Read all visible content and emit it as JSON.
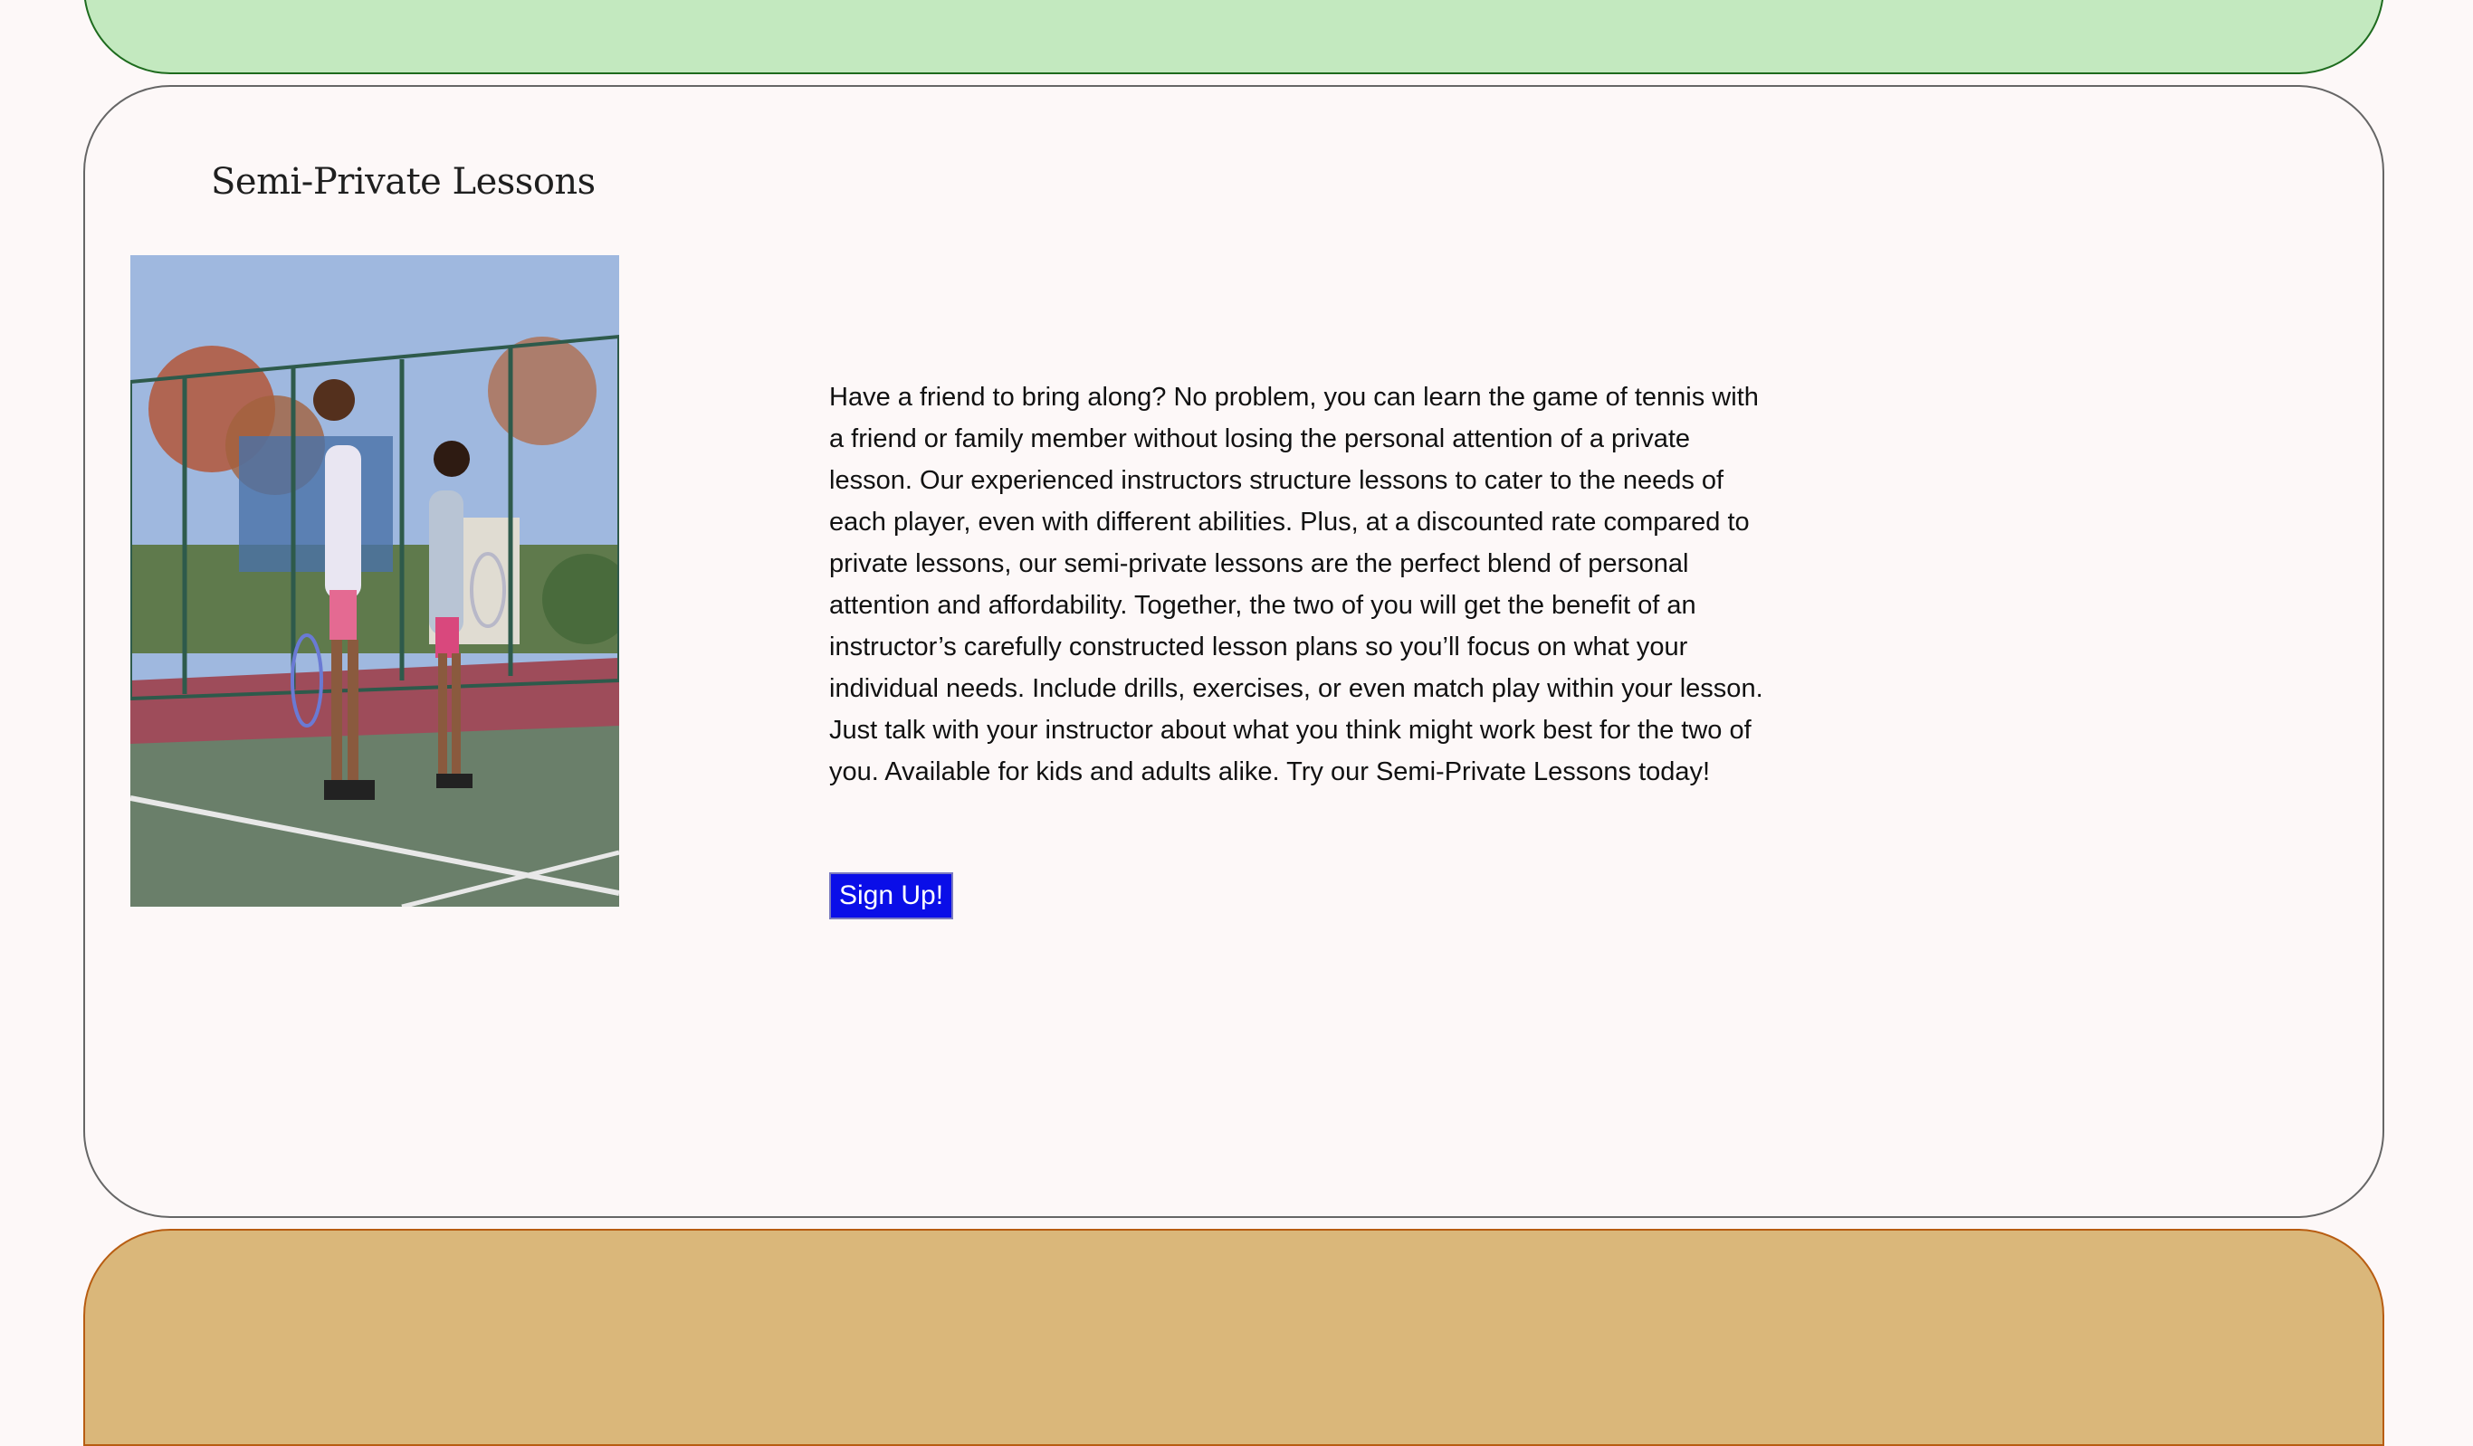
{
  "section": {
    "title": "Semi-Private Lessons",
    "description": "Have a friend to bring along? No problem, you can learn the game of tennis with a friend or family member without losing the personal attention of a private lesson. Our experienced instructors structure lessons to cater to the needs of each player, even with different abilities. Plus, at a discounted rate compared to private lessons, our semi-private lessons are the perfect blend of personal attention and affordability. Together, the two of you will get the benefit of an instructor’s carefully constructed lesson plans so you’ll focus on what your individual needs. Include drills, exercises, or even match play within your lesson. Just talk with your instructor about what you think might work best for the two of you. Available for kids and adults alike. Try our Semi-Private Lessons today!",
    "signup_label": "Sign Up!"
  },
  "colors": {
    "top_panel_fill": "#c3e9bf",
    "top_panel_border": "#1e6b1e",
    "main_panel_border": "#666666",
    "bottom_panel_fill": "#dab77a",
    "bottom_panel_border": "#b85d12",
    "page_background": "#fdf8f8",
    "button_fill": "#0a0ee8"
  }
}
